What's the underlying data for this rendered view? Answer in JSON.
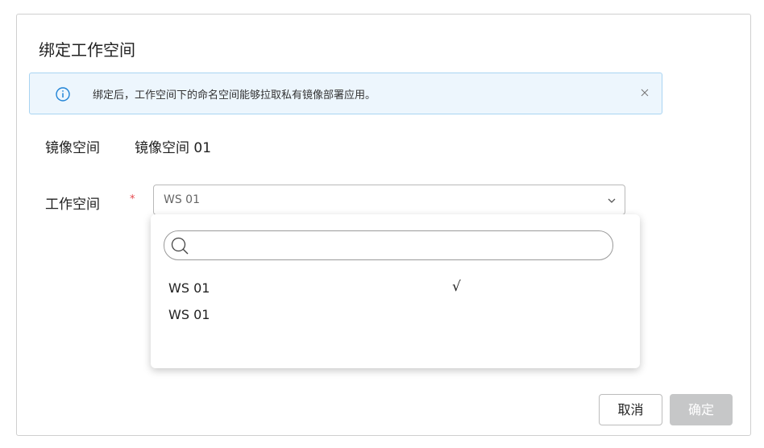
{
  "dialog": {
    "title": "绑定工作空间",
    "alert": {
      "text": "绑定后，工作空间下的命名空间能够拉取私有镜像部署应用。",
      "info_icon": "info-circle-icon",
      "close_icon": "close-icon"
    },
    "registry": {
      "label": "镜像空间",
      "value": "镜像空间 01"
    },
    "workspace": {
      "label": "工作空间",
      "required_mark": "*",
      "selected_value": "WS 01",
      "search_placeholder": "",
      "options": [
        {
          "label": "WS 01",
          "checked": true,
          "check_mark": "√"
        },
        {
          "label": "WS 01",
          "checked": false
        }
      ]
    },
    "buttons": {
      "cancel": "取消",
      "confirm": "确定"
    }
  },
  "colors": {
    "alert_bg": "#edf6fd",
    "alert_border": "#a9d4f2",
    "info_icon": "#1f83d6",
    "required": "#e5484d",
    "confirm_disabled": "#c6c7c8"
  }
}
